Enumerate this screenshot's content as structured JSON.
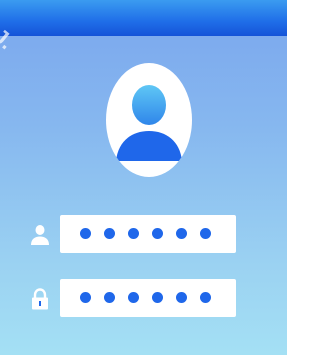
{
  "watermark": {
    "text": "J."
  },
  "avatar": {
    "icon": "user-avatar-icon",
    "colors": {
      "head_top": "#5fc7f5",
      "head_bottom": "#2f86ea",
      "body": "#1f67ea"
    }
  },
  "username_field": {
    "icon": "user-icon",
    "value": "••••••",
    "masked_char_count": 6
  },
  "password_field": {
    "icon": "lock-icon",
    "value": "••••••",
    "masked_char_count": 6
  },
  "colors": {
    "header_top": "#3b9bf0",
    "header_bottom": "#1553d8",
    "background_top": "#7aa6ee",
    "background_bottom": "#a4e0f4",
    "dot": "#1f67ea",
    "input_bg": "#ffffff"
  }
}
